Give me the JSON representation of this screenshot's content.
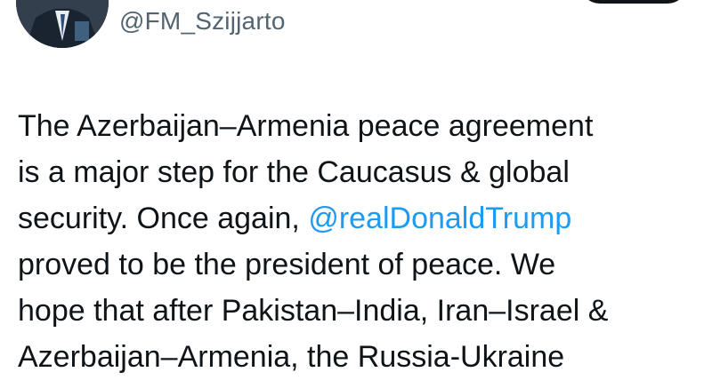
{
  "author": {
    "handle": "@FM_Szijjarto"
  },
  "tweet": {
    "line1": "The Azerbaijan–Armenia peace agreement",
    "line2": "is a major step for the Caucasus & global",
    "line3_before": "security. Once again, ",
    "mention": "@realDonaldTrump",
    "line4": "proved to be the president of peace. We",
    "line5": "hope that after Pakistan–India, Iran–Israel &",
    "line6": "Azerbaijan–Armenia, the Russia-Ukraine"
  },
  "colors": {
    "text": "#0f1419",
    "secondary_text": "#536471",
    "mention": "#1d9bf0",
    "background": "#ffffff",
    "follow_button": "#0f1419"
  }
}
